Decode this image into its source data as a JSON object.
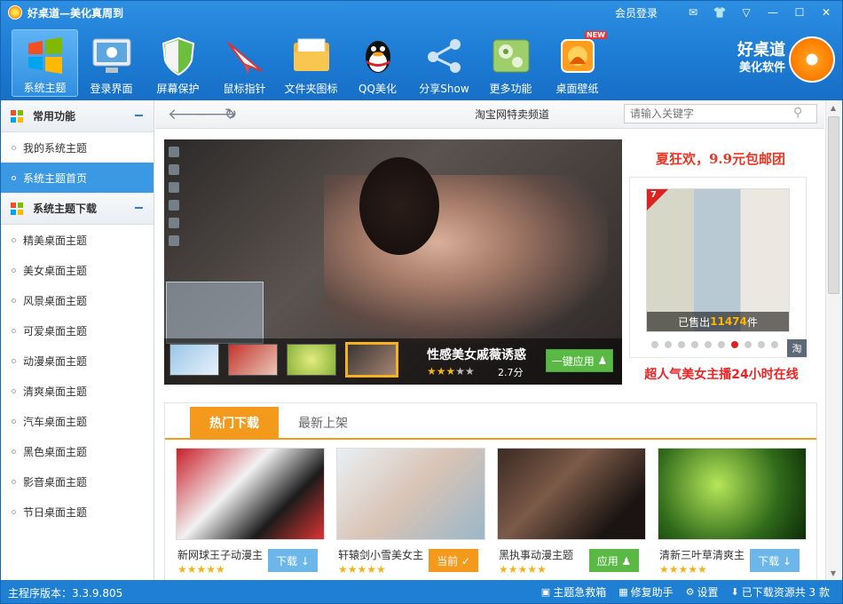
{
  "window": {
    "title": "好桌道—美化真周到",
    "login": "会员登录",
    "controls": [
      "✉",
      "👕",
      "▽",
      "—",
      "☐",
      "✕"
    ]
  },
  "toolbar": {
    "items": [
      {
        "label": "系统主题",
        "icon": "windows-logo-icon",
        "active": true
      },
      {
        "label": "登录界面",
        "icon": "monitor-icon"
      },
      {
        "label": "屏幕保护",
        "icon": "shield-icon"
      },
      {
        "label": "鼠标指针",
        "icon": "paper-plane-icon"
      },
      {
        "label": "文件夹图标",
        "icon": "folder-icon"
      },
      {
        "label": "QQ美化",
        "icon": "qq-penguin-icon"
      },
      {
        "label": "分享Show",
        "icon": "share-icon"
      },
      {
        "label": "更多功能",
        "icon": "gear-power-icon"
      },
      {
        "label": "桌面壁纸",
        "icon": "wallpaper-icon",
        "badge": "NEW"
      }
    ],
    "brand_line1": "好桌道",
    "brand_line2": "美化软件"
  },
  "sidebar": {
    "section1": "常用功能",
    "section1_items": [
      "我的系统主题",
      "系统主题首页"
    ],
    "section2": "系统主题下载",
    "section2_items": [
      "精美桌面主题",
      "美女桌面主题",
      "风景桌面主题",
      "可爱桌面主题",
      "动漫桌面主题",
      "清爽桌面主题",
      "汽车桌面主题",
      "黑色桌面主题",
      "影音桌面主题",
      "节日桌面主题"
    ]
  },
  "navbar": {
    "center": "淘宝网特卖频道",
    "search_placeholder": "请输入关键字"
  },
  "banner": {
    "title": "性感美女戚薇诱惑",
    "rating": 2.5,
    "score": "2.7分",
    "apply": "一键应用"
  },
  "ad": {
    "headline": "夏狂欢，9.9元包邮团",
    "badge": "7",
    "sold_prefix": "已售出",
    "sold_count": "11474",
    "sold_suffix": "件",
    "tao": "淘",
    "footer": "超人气美女主播24小时在线",
    "dots": 10,
    "active_dot": 6
  },
  "tabs": [
    "热门下载",
    "最新上架"
  ],
  "cards": [
    {
      "name": "新网球王子动漫主",
      "rating": 4.5,
      "button": "下载 ↓",
      "btype": "dl"
    },
    {
      "name": "轩辕剑小雪美女主",
      "rating": 4.5,
      "button": "当前 ✓",
      "btype": "cur"
    },
    {
      "name": "黑执事动漫主题",
      "rating": 5,
      "button": "应用 ♟",
      "btype": "ap"
    },
    {
      "name": "清新三叶草清爽主",
      "rating": 4.5,
      "button": "下载 ↓",
      "btype": "dl"
    }
  ],
  "status": {
    "version": "主程序版本：3.3.9.805",
    "items": [
      {
        "icon": "▣",
        "label": "主题急救箱"
      },
      {
        "icon": "▦",
        "label": "修复助手"
      },
      {
        "icon": "⚙",
        "label": "设置"
      },
      {
        "icon": "⬇",
        "label": "已下载资源共 3 款"
      }
    ]
  },
  "colors": {
    "accent": "#1f7fd2",
    "orange": "#f39a1c",
    "green": "#5ab845"
  }
}
